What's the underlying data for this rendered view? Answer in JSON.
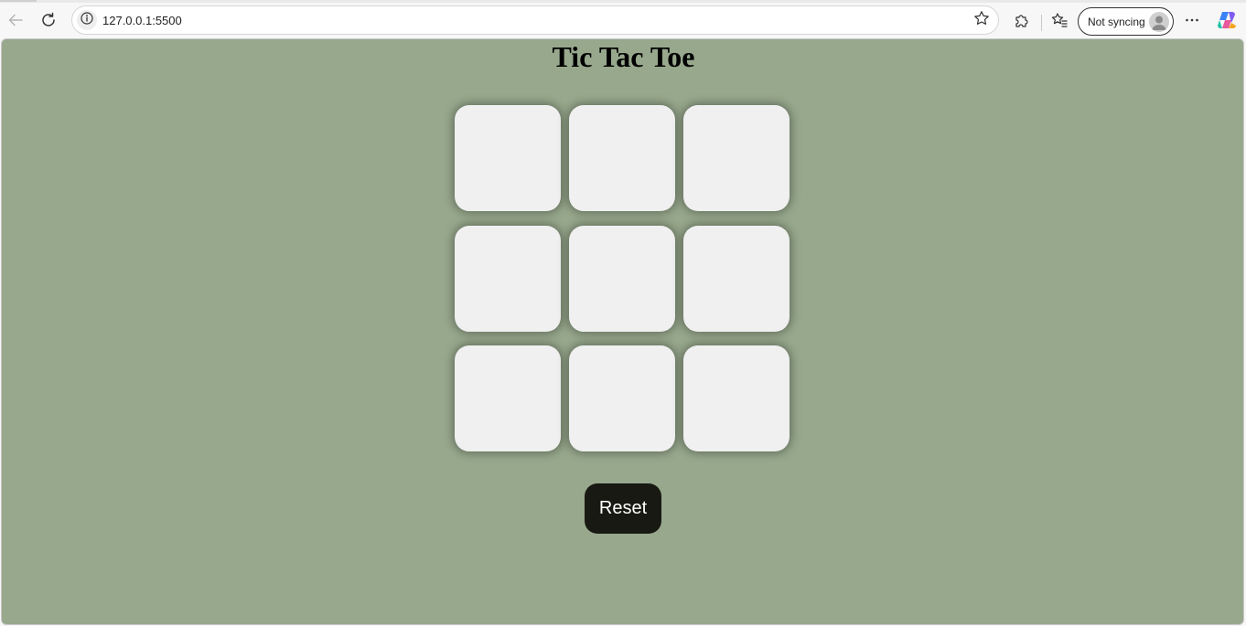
{
  "browser": {
    "url": "127.0.0.1:5500",
    "profile_label": "Not syncing",
    "icons": {
      "back": "back-arrow-icon",
      "reload": "reload-icon",
      "site_info": "info-icon",
      "favorite": "star-icon",
      "extensions": "puzzle-icon",
      "favorites_bar": "favorites-icon",
      "more": "more-dots-icon",
      "copilot": "copilot-icon"
    }
  },
  "page": {
    "title": "Tic Tac Toe",
    "background_color": "#97a88c",
    "cell_color": "#f0f0f0",
    "board": [
      "",
      "",
      "",
      "",
      "",
      "",
      "",
      "",
      ""
    ],
    "reset_label": "Reset",
    "reset_color": "#191913"
  }
}
